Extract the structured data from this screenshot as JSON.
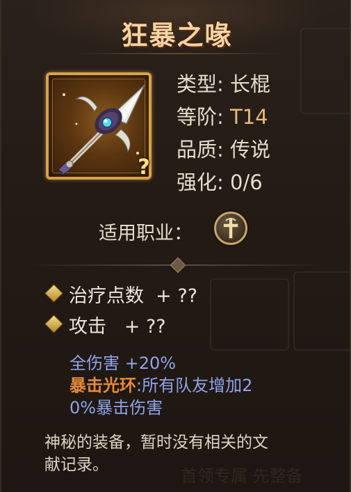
{
  "title": "狂暴之喙",
  "info": [
    {
      "label": "类型: ",
      "value": "长棍"
    },
    {
      "label": "等阶: ",
      "value": "T14"
    },
    {
      "label": "品质: ",
      "value": "传说"
    },
    {
      "label": "强化: ",
      "value": "0/6"
    }
  ],
  "class_label": "适用职业：",
  "class_icon": "holy-cross-icon",
  "badge": "?",
  "stats": [
    {
      "text": "治疗点数  + ??"
    },
    {
      "text": "攻击   + ??"
    }
  ],
  "bonus_damage": "全伤害 +20%",
  "aura": {
    "name": "暴击光环",
    "line1_rest": ":所有队友增加2",
    "line2": "0%暴击伤害"
  },
  "description_line1": "神秘的装备，暂时没有相关的文",
  "description_line2": "献记录。",
  "watermark": "首领专属 先整备",
  "colors": {
    "title": "#f3d2a4",
    "tier_value": "#e9b97a",
    "bonus_blue": "#8fa4e8",
    "aura_orange": "#e58a3a",
    "frame_gold": "#d9a24a"
  }
}
